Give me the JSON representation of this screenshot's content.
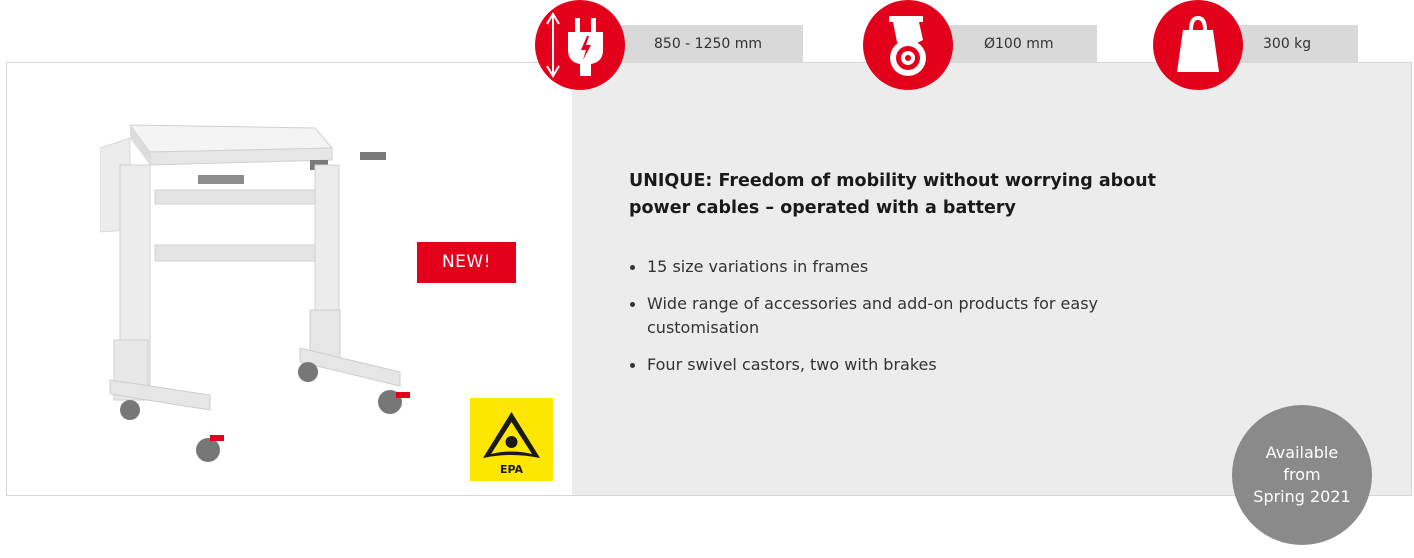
{
  "specs": [
    {
      "icon": "height-plug-icon",
      "label": "850 - 1250 mm"
    },
    {
      "icon": "castor-wheel-icon",
      "label": "Ø100 mm"
    },
    {
      "icon": "weight-icon",
      "label": "300 kg"
    }
  ],
  "badges": {
    "new": "NEW!",
    "epa": "EPA"
  },
  "content": {
    "headline": "UNIQUE: Freedom of mobility without worrying about power cables – operated with a battery",
    "features": [
      "15 size variations in frames",
      "Wide range of accessories and add-on products for easy customisation",
      "Four swivel castors, two with brakes"
    ]
  },
  "availability": {
    "line1": "Available",
    "line2": "from",
    "line3": "Spring 2021"
  },
  "colors": {
    "accent": "#e3001b",
    "panel": "#ececec",
    "spec_label_bg": "#d9d9d9",
    "availability_bg": "#8a8a8a",
    "epa_bg": "#fde700"
  }
}
